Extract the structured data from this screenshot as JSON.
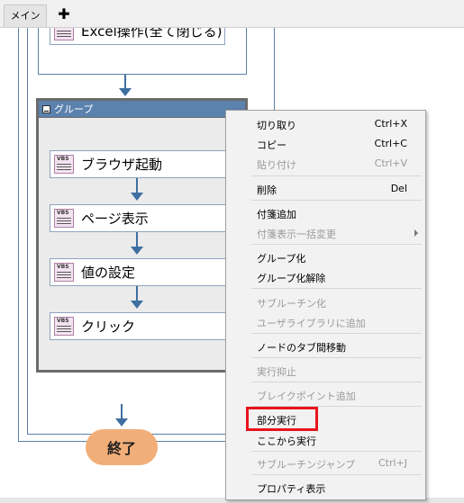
{
  "tabs": {
    "main_label": "メイン",
    "add_label": "✚"
  },
  "flow": {
    "top_node_label": "Excel操作(全て閉じる)",
    "group_title": "グループ",
    "nodes": [
      {
        "label": "ブラウザ起動",
        "icon": "vbs-script-icon",
        "icon_text": "VBS"
      },
      {
        "label": "ページ表示",
        "icon": "vbs-script-icon",
        "icon_text": "VBS"
      },
      {
        "label": "値の設定",
        "icon": "vbs-script-icon",
        "icon_text": "VBS"
      },
      {
        "label": "クリック",
        "icon": "vbs-script-icon",
        "icon_text": "VBS"
      }
    ],
    "end_label": "終了"
  },
  "context_menu": {
    "items": [
      {
        "label": "切り取り",
        "shortcut": "Ctrl+X",
        "enabled": true
      },
      {
        "label": "コピー",
        "shortcut": "Ctrl+C",
        "enabled": true
      },
      {
        "label": "貼り付け",
        "shortcut": "Ctrl+V",
        "enabled": false
      },
      {
        "label": "削除",
        "shortcut": "Del",
        "enabled": true
      },
      {
        "label": "付箋追加",
        "shortcut": "",
        "enabled": true
      },
      {
        "label": "付箋表示一括変更",
        "shortcut": "",
        "enabled": false,
        "submenu": true
      },
      {
        "label": "グループ化",
        "shortcut": "",
        "enabled": true
      },
      {
        "label": "グループ化解除",
        "shortcut": "",
        "enabled": true
      },
      {
        "label": "サブルーチン化",
        "shortcut": "",
        "enabled": false
      },
      {
        "label": "ユーザライブラリに追加",
        "shortcut": "",
        "enabled": false
      },
      {
        "label": "ノードのタブ間移動",
        "shortcut": "",
        "enabled": true
      },
      {
        "label": "実行抑止",
        "shortcut": "",
        "enabled": false
      },
      {
        "label": "ブレイクポイント追加",
        "shortcut": "",
        "enabled": false
      },
      {
        "label": "部分実行",
        "shortcut": "",
        "enabled": true,
        "highlighted": true
      },
      {
        "label": "ここから実行",
        "shortcut": "",
        "enabled": true
      },
      {
        "label": "サブルーチンジャンプ",
        "shortcut": "Ctrl+J",
        "enabled": false
      },
      {
        "label": "プロパティ表示",
        "shortcut": "",
        "enabled": true
      }
    ]
  },
  "colors": {
    "flow_line": "#3f6fa0",
    "group_header": "#5b81ad",
    "end_node": "#f2ae78",
    "highlight": "#e8141c"
  }
}
